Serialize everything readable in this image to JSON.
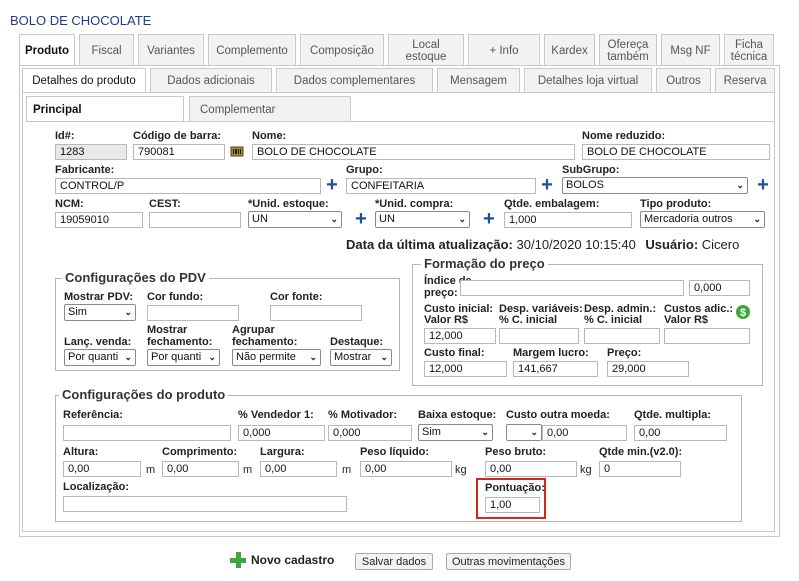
{
  "window": {
    "title": "BOLO DE CHOCOLATE"
  },
  "tabs_main": [
    "Produto",
    "Fiscal",
    "Variantes",
    "Complemento",
    "Composição",
    "Local estoque",
    "+ Info",
    "Kardex",
    "Ofereça também",
    "Msg NF",
    "Ficha técnica"
  ],
  "tabs_sub": [
    "Detalhes do produto",
    "Dados adicionais",
    "Dados complementares",
    "Mensagem",
    "Detalhes loja virtual",
    "Outros",
    "Reserva"
  ],
  "tabs_inner": [
    "Principal",
    "Complementar"
  ],
  "fields": {
    "id": {
      "label": "Id#:",
      "value": "1283"
    },
    "barcode": {
      "label": "Código de barra:",
      "value": "790081"
    },
    "name": {
      "label": "Nome:",
      "value": "BOLO DE CHOCOLATE"
    },
    "short_name": {
      "label": "Nome reduzido:",
      "value": "BOLO DE CHOCOLATE"
    },
    "manufacturer": {
      "label": "Fabricante:",
      "value": "CONTROL/P"
    },
    "group": {
      "label": "Grupo:",
      "value": "CONFEITARIA"
    },
    "subgroup": {
      "label": "SubGrupo:",
      "value": "BOLOS"
    },
    "ncm": {
      "label": "NCM:",
      "value": "19059010"
    },
    "cest": {
      "label": "CEST:",
      "value": ""
    },
    "unit_stock": {
      "label": "*Unid. estoque:",
      "value": "UN"
    },
    "unit_purchase": {
      "label": "*Unid. compra:",
      "value": "UN"
    },
    "qty_package": {
      "label": "Qtde. embalagem:",
      "value": "1,000"
    },
    "product_type": {
      "label": "Tipo produto:",
      "value": "Mercadoria outros"
    }
  },
  "last_update": {
    "label": "Data da última atualização:",
    "date": "30/10/2020 10:15:40",
    "user_label": "Usuário:",
    "user": "Cicero"
  },
  "pdv": {
    "title": "Configurações do PDV",
    "show_pdv": {
      "label": "Mostrar PDV:",
      "value": "Sim"
    },
    "bg_color": {
      "label": "Cor fundo:",
      "value": ""
    },
    "font_color": {
      "label": "Cor fonte:",
      "value": ""
    },
    "launch_sale": {
      "label": "Lanç. venda:",
      "value": "Por quanti"
    },
    "show_closing": {
      "label1": "Mostrar",
      "label2": "fechamento:",
      "value": "Por quanti"
    },
    "group_closing": {
      "label1": "Agrupar",
      "label2": "fechamento:",
      "value": "Não permite"
    },
    "highlight": {
      "label": "Destaque:",
      "value": "Mostrar"
    }
  },
  "price": {
    "title": "Formação do preço",
    "index": {
      "label1": "Índice de",
      "label2": "preço:",
      "value": "",
      "value2": "0,000"
    },
    "cost_initial": {
      "label1": "Custo inicial:",
      "label2": "Valor R$",
      "value": "12,000"
    },
    "var_expenses": {
      "label1": "Desp. variáveis:",
      "label2": "% C. inicial",
      "value": ""
    },
    "admin_expenses": {
      "label1": "Desp. admin.:",
      "label2": "% C. inicial",
      "value": ""
    },
    "additional_costs": {
      "label1": "Custos adic.:",
      "label2": "Valor R$",
      "value": ""
    },
    "final_cost": {
      "label": "Custo final:",
      "value": "12,000"
    },
    "profit_margin": {
      "label": "Margem lucro:",
      "value": "141,667"
    },
    "price": {
      "label": "Preço:",
      "value": "29,000"
    }
  },
  "product_config": {
    "title": "Configurações do produto",
    "reference": {
      "label": "Referência:",
      "value": ""
    },
    "seller_pct": {
      "label": "% Vendedor 1:",
      "value": "0,000"
    },
    "motivator_pct": {
      "label": "% Motivador:",
      "value": "0,000"
    },
    "low_stock": {
      "label": "Baixa estoque:",
      "value": "Sim"
    },
    "other_currency_cost": {
      "label": "Custo outra moeda:",
      "value": "",
      "value2": "0,00"
    },
    "multiple_qty": {
      "label": "Qtde. multipla:",
      "value": "0,00"
    },
    "height": {
      "label": "Altura:",
      "value": "0,00",
      "unit": "m"
    },
    "length": {
      "label": "Comprimento:",
      "value": "0,00",
      "unit": "m"
    },
    "width": {
      "label": "Largura:",
      "value": "0,00",
      "unit": "m"
    },
    "net_weight": {
      "label": "Peso líquido:",
      "value": "0,00",
      "unit": "kg"
    },
    "gross_weight": {
      "label": "Peso bruto:",
      "value": "0,00",
      "unit": "kg"
    },
    "min_qty": {
      "label": "Qtde min.(v2.0):",
      "value": "0"
    },
    "location": {
      "label": "Localização:",
      "value": ""
    },
    "score": {
      "label": "Pontuação:",
      "value": "1,00"
    }
  },
  "footer": {
    "new_label": "Novo cadastro",
    "save_label": "Salvar dados",
    "other_label": "Outras movimentações"
  },
  "colors": {
    "title": "#1f3c8a",
    "plus": "#1f4fa0",
    "highlight_box": "#d9231d",
    "green": "#3aa83a"
  }
}
